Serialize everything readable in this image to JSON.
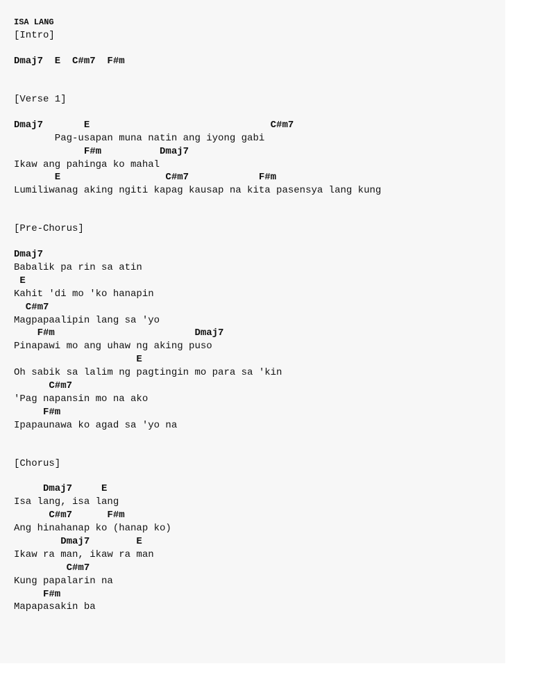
{
  "title": "ISA LANG",
  "intro": {
    "label": "[Intro]",
    "chords": "Dmaj7  E  C#m7  F#m"
  },
  "verse1": {
    "label": "[Verse 1]",
    "l1_chords": "Dmaj7       E                               C#m7",
    "l1_lyric": "       Pag-usapan muna natin ang iyong gabi",
    "l2_chords": "            F#m          Dmaj7",
    "l2_lyric": "Ikaw ang pahinga ko mahal",
    "l3_chords": "       E                  C#m7            F#m",
    "l3_lyric": "Lumiliwanag aking ngiti kapag kausap na kita pasensya lang kung"
  },
  "prechorus": {
    "label": "[Pre-Chorus]",
    "l1_chords": "Dmaj7",
    "l1_lyric": "Babalik pa rin sa atin",
    "l2_chords": " E",
    "l2_lyric": "Kahit 'di mo 'ko hanapin",
    "l3_chords": "  C#m7",
    "l3_lyric": "Magpapaalipin lang sa 'yo",
    "l4_chords": "    F#m                        Dmaj7",
    "l4_lyric": "Pinapawi mo ang uhaw ng aking puso",
    "l5_chords": "                     E",
    "l5_lyric": "Oh sabik sa lalim ng pagtingin mo para sa 'kin",
    "l6_chords": "      C#m7",
    "l6_lyric": "'Pag napansin mo na ako",
    "l7_chords": "     F#m",
    "l7_lyric": "Ipapaunawa ko agad sa 'yo na"
  },
  "chorus": {
    "label": "[Chorus]",
    "l1_chords": "     Dmaj7     E",
    "l1_lyric": "Isa lang, isa lang",
    "l2_chords": "      C#m7      F#m",
    "l2_lyric": "Ang hinahanap ko (hanap ko)",
    "l3_chords": "        Dmaj7        E",
    "l3_lyric": "Ikaw ra man, ikaw ra man",
    "l4_chords": "         C#m7",
    "l4_lyric": "Kung papalarin na",
    "l5_chords": "     F#m",
    "l5_lyric": "Mapapasakin ba"
  }
}
